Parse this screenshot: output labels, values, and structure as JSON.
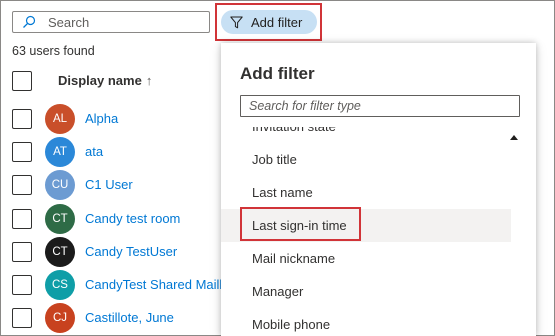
{
  "search": {
    "placeholder": "Search",
    "icon": "search-icon"
  },
  "toolbar": {
    "add_filter_label": "Add filter",
    "add_filter_icon": "funnel-icon",
    "highlight_color": "#d13438"
  },
  "users_count": "63 users found",
  "table": {
    "column_header": "Display name",
    "sort_arrow": "↑",
    "rows": [
      {
        "initials": "AL",
        "name": "Alpha",
        "avatar_color": "#c94f2a"
      },
      {
        "initials": "AT",
        "name": "ata",
        "avatar_color": "#2b88d8"
      },
      {
        "initials": "CU",
        "name": "C1 User",
        "avatar_color": "#6c9bd2"
      },
      {
        "initials": "CT",
        "name": "Candy test room",
        "avatar_color": "#2e6b46"
      },
      {
        "initials": "CT",
        "name": "Candy TestUser",
        "avatar_color": "#1b1b1b"
      },
      {
        "initials": "CS",
        "name": "CandyTest Shared Mailbox",
        "avatar_color": "#0f9ea7"
      },
      {
        "initials": "CJ",
        "name": "Castillote, June",
        "avatar_color": "#c8421f"
      }
    ]
  },
  "filter_panel": {
    "title": "Add filter",
    "search_placeholder": "Search for filter type",
    "items": [
      "Invitation state",
      "Job title",
      "Last name",
      "Last sign-in time",
      "Mail nickname",
      "Manager",
      "Mobile phone"
    ],
    "highlighted_item": "Last sign-in time"
  }
}
